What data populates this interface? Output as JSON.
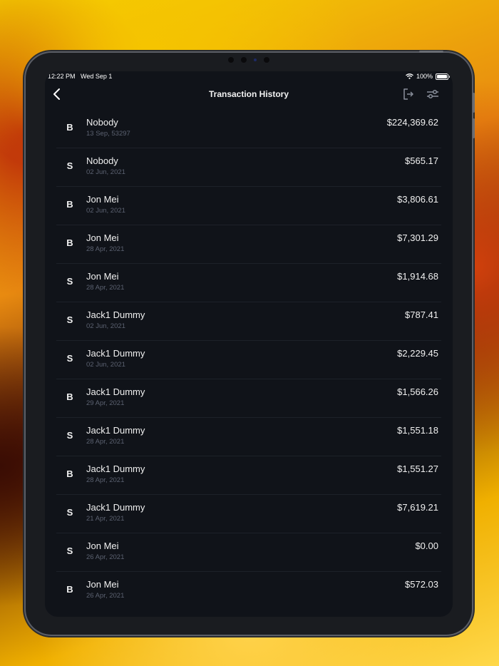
{
  "statusbar": {
    "time": "12:22 PM",
    "date": "Wed Sep 1",
    "battery": "100%"
  },
  "header": {
    "title": "Transaction History"
  },
  "icons": {
    "back": "chevron-left-icon",
    "export": "export-icon",
    "filter": "sliders-icon",
    "wifi": "wifi-icon",
    "battery": "battery-icon"
  },
  "transactions": [
    {
      "type": "B",
      "name": "Nobody",
      "date": "13 Sep, 53297",
      "amount": "$224,369.62"
    },
    {
      "type": "S",
      "name": "Nobody",
      "date": "02 Jun, 2021",
      "amount": "$565.17"
    },
    {
      "type": "B",
      "name": "Jon Mei",
      "date": "02 Jun, 2021",
      "amount": "$3,806.61"
    },
    {
      "type": "B",
      "name": "Jon Mei",
      "date": "28 Apr, 2021",
      "amount": "$7,301.29"
    },
    {
      "type": "S",
      "name": "Jon Mei",
      "date": "28 Apr, 2021",
      "amount": "$1,914.68"
    },
    {
      "type": "S",
      "name": "Jack1 Dummy",
      "date": "02 Jun, 2021",
      "amount": "$787.41"
    },
    {
      "type": "S",
      "name": "Jack1 Dummy",
      "date": "02 Jun, 2021",
      "amount": "$2,229.45"
    },
    {
      "type": "B",
      "name": "Jack1 Dummy",
      "date": "29 Apr, 2021",
      "amount": "$1,566.26"
    },
    {
      "type": "S",
      "name": "Jack1 Dummy",
      "date": "28 Apr, 2021",
      "amount": "$1,551.18"
    },
    {
      "type": "B",
      "name": "Jack1 Dummy",
      "date": "28 Apr, 2021",
      "amount": "$1,551.27"
    },
    {
      "type": "S",
      "name": "Jack1 Dummy",
      "date": "21 Apr, 2021",
      "amount": "$7,619.21"
    },
    {
      "type": "S",
      "name": "Jon Mei",
      "date": "26 Apr, 2021",
      "amount": "$0.00"
    },
    {
      "type": "B",
      "name": "Jon Mei",
      "date": "26 Apr, 2021",
      "amount": "$572.03"
    }
  ]
}
